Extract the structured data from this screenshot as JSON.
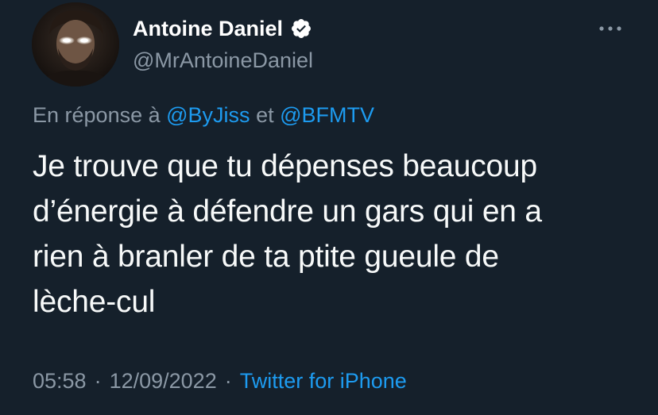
{
  "author": {
    "display_name": "Antoine Daniel",
    "handle": "@MrAntoineDaniel",
    "verified_icon": "verified-badge-icon"
  },
  "menu": {
    "icon": "more-options-icon"
  },
  "reply": {
    "prefix": "En réponse à",
    "mention_1": "@ByJiss",
    "conjunction": "et",
    "mention_2": "@BFMTV"
  },
  "tweet": {
    "text": "Je trouve que tu dépenses beaucoup\nd’énergie à défendre un gars qui en a\nrien à branler de ta ptite gueule de\nlèche-cul"
  },
  "meta": {
    "time": "05:58",
    "date": "12/09/2022",
    "separator": "·",
    "source": "Twitter for iPhone"
  },
  "colors": {
    "background": "#15202b",
    "primary_text": "#f7f9f9",
    "secondary_text": "#8b98a5",
    "accent": "#1d9bf0"
  }
}
